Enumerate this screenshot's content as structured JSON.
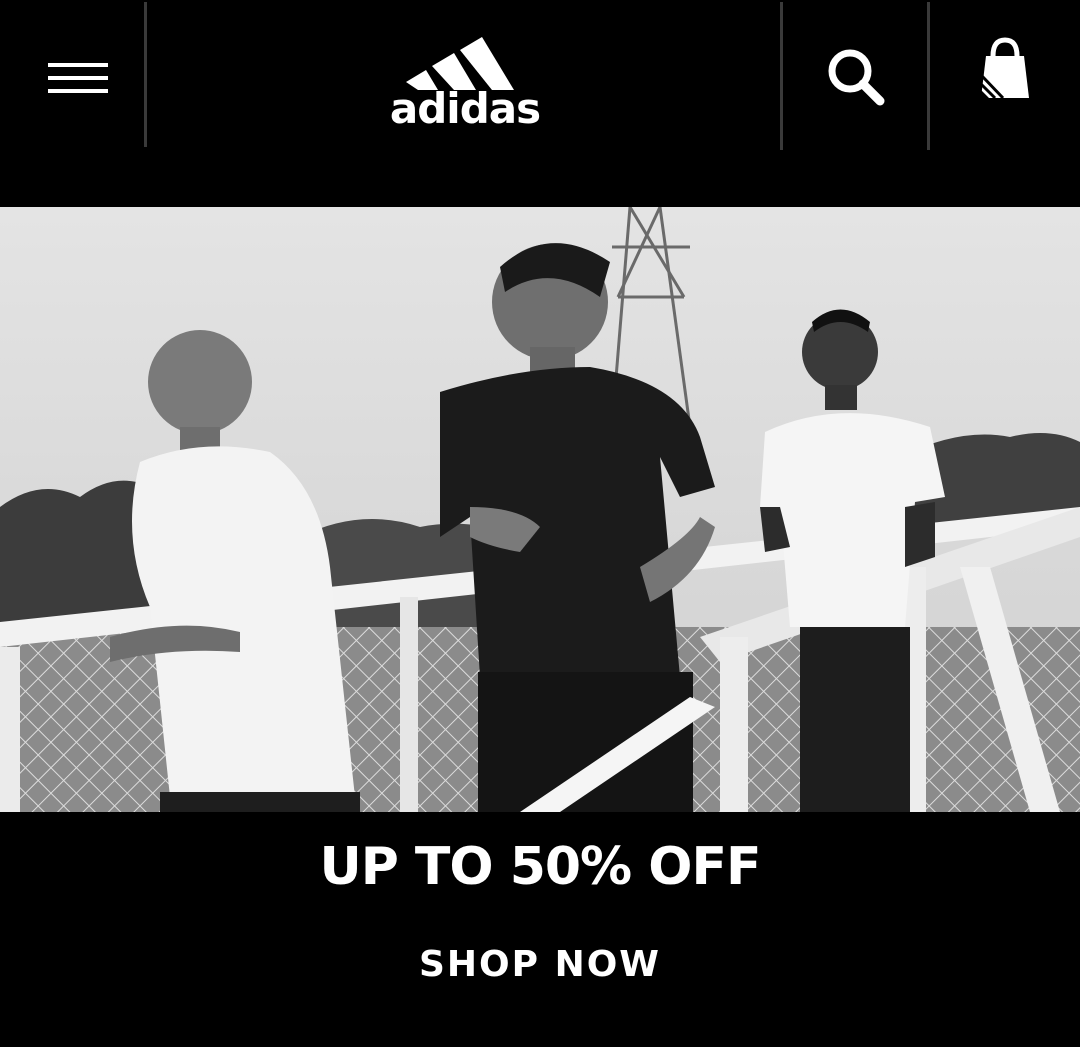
{
  "header": {
    "brand": "adidas",
    "menu_icon": "hamburger-menu-icon",
    "search_icon": "search-icon",
    "cart_icon": "shopping-bag-icon"
  },
  "hero": {
    "image": "black-and-white photo of three men running across a bridge with chain-link fence"
  },
  "promo": {
    "title": "UP TO 50% OFF",
    "cta_label": "SHOP NOW"
  },
  "colors": {
    "background": "#000000",
    "text": "#ffffff",
    "divider": "#3a3a3a"
  }
}
